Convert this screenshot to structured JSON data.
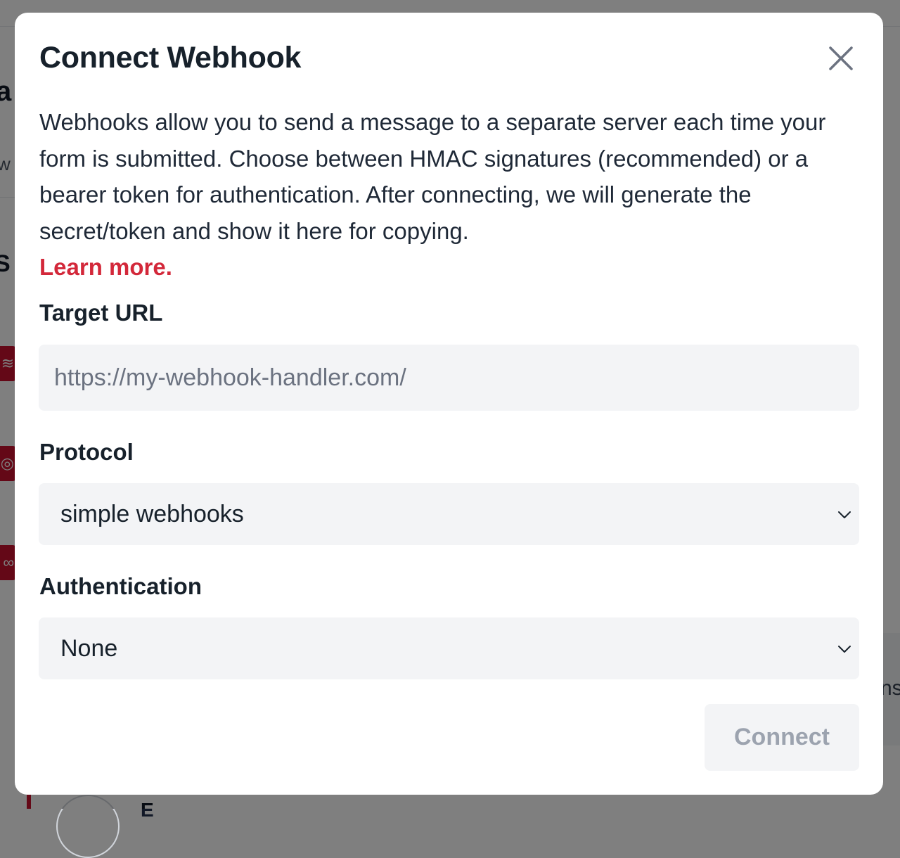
{
  "background": {
    "fragment_title": "a",
    "fragment_subtitle": "w",
    "fragment_section": "S",
    "fragment_right": "ns",
    "fragment_bottom": "E"
  },
  "modal": {
    "title": "Connect Webhook",
    "close_icon": "close-icon",
    "description": "Webhooks allow you to send a message to a separate server each time your form is submitted. Choose between HMAC signatures (recommended) or a bearer token for authentication. After connecting, we will generate the secret/token and show it here for copying.",
    "learn_more": "Learn more.",
    "target_url": {
      "label": "Target URL",
      "value": "",
      "placeholder": "https://my-webhook-handler.com/"
    },
    "protocol": {
      "label": "Protocol",
      "selected": "simple webhooks"
    },
    "authentication": {
      "label": "Authentication",
      "selected": "None"
    },
    "connect_label": "Connect"
  },
  "colors": {
    "accent_red": "#d3283a",
    "field_bg": "#f3f4f6",
    "text_dark": "#17212b",
    "disabled_text": "#9ca3af"
  }
}
